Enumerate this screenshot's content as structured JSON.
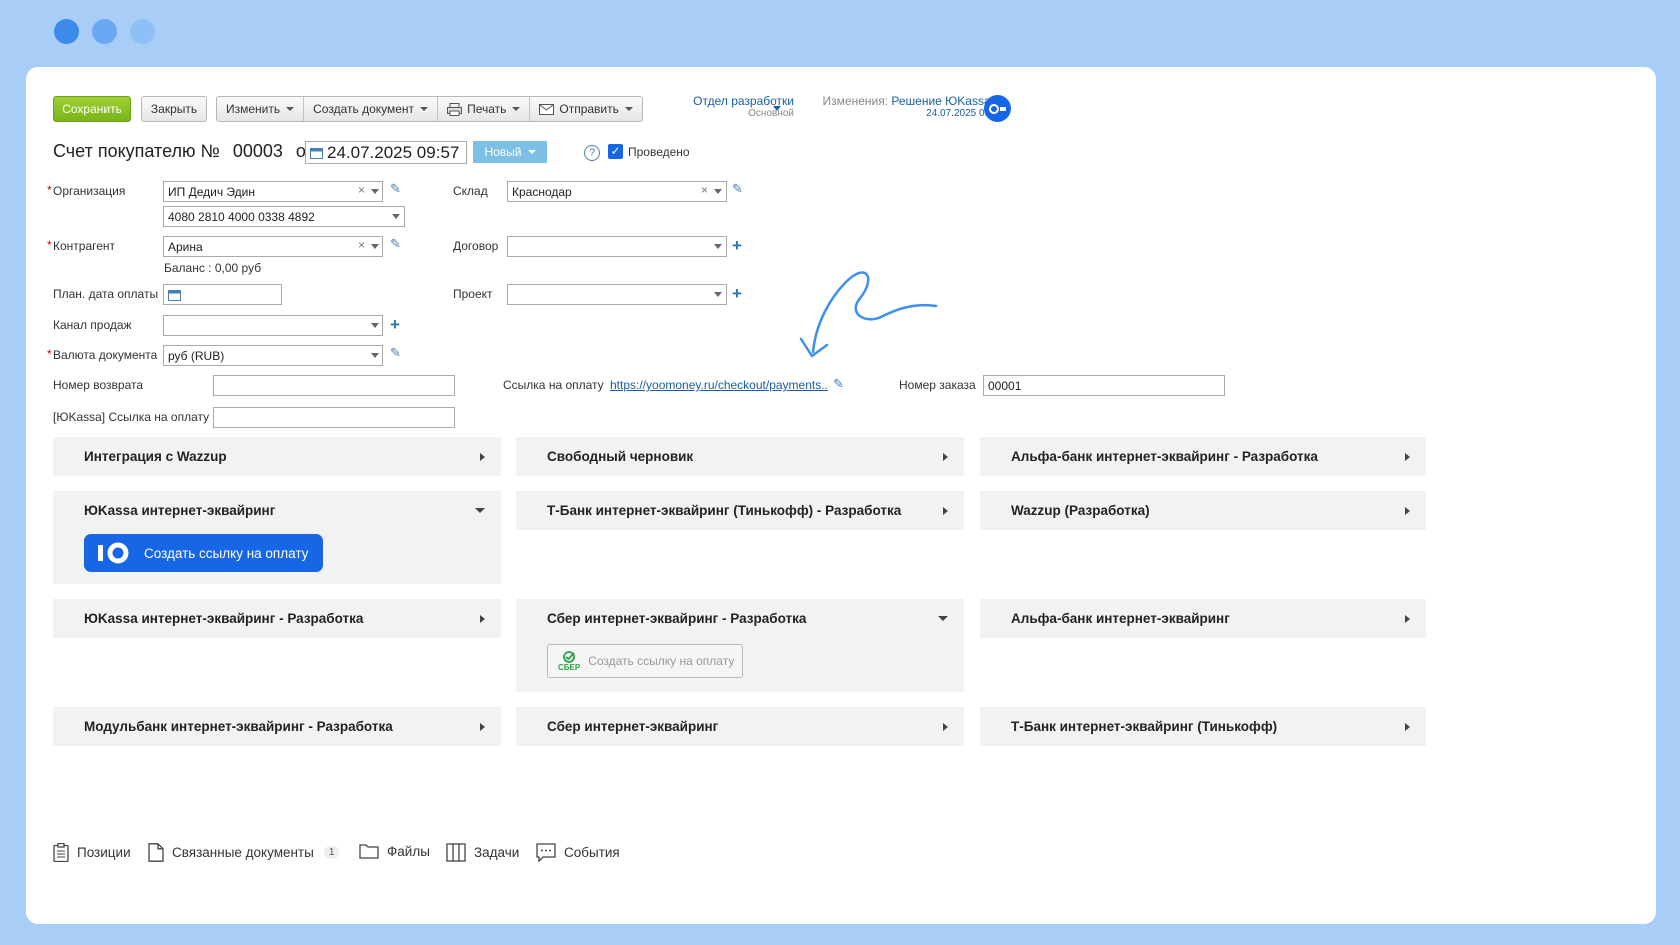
{
  "colors": {
    "frame": "#a8cdf6",
    "save": "#8cc229",
    "link": "#1a5fa3",
    "accent": "#1766e6"
  },
  "toolbar": {
    "save": "Сохранить",
    "close": "Закрыть",
    "edit": "Изменить",
    "create_doc": "Создать документ",
    "print": "Печать",
    "send": "Отправить"
  },
  "dept": {
    "name": "Отдел разработки",
    "sub": "Основной"
  },
  "changes": {
    "label": "Изменения:",
    "value": "Решение ЮKassa ...",
    "date": "24.07.2025 09:57"
  },
  "header": {
    "title": "Счет покупателю №",
    "number": "00003",
    "from": "от",
    "date": "24.07.2025 09:57",
    "status": "Новый",
    "posted": "Проведено",
    "help": "?"
  },
  "form": {
    "org_label": "Организация",
    "org_value": "ИП Дедич Эдин",
    "account_value": "4080 2810 4000 0338 4892",
    "warehouse_label": "Склад",
    "warehouse_value": "Краснодар",
    "contractor_label": "Контрагент",
    "contractor_value": "Арина",
    "balance": "Баланс : 0,00 руб",
    "contract_label": "Договор",
    "pay_date_label": "План. дата оплаты",
    "project_label": "Проект",
    "channel_label": "Канал продаж",
    "currency_label": "Валюта документа",
    "currency_value": "руб (RUB)",
    "return_label": "Номер возврата",
    "pay_link_label": "Ссылка на оплату",
    "pay_link_value": "https://yoomoney.ru/checkout/payments...",
    "order_label": "Номер заказа",
    "order_value": "00001",
    "yk_link_label": "[ЮKassa] Ссылка на оплату"
  },
  "panels": {
    "p1": "Интеграция с Wazzup",
    "p2": "Свободный черновик",
    "p3": "Альфа-банк интернет-эквайринг - Разработка",
    "p4": "ЮKassa интернет-эквайринг",
    "p5": "Т-Банк интернет-эквайринг (Тинькофф) - Разработка",
    "p6": "Wazzup (Разработка)",
    "p7": "ЮKassa интернет-эквайринг - Разработка",
    "p8": "Сбер интернет-эквайринг - Разработка",
    "p9": "Альфа-банк интернет-эквайринг",
    "p10": "Модульбанк интернет-эквайринг - Разработка",
    "p11": "Сбер интернет-эквайринг",
    "p12": "Т-Банк интернет-эквайринг (Тинькофф)",
    "yk_button": "Создать ссылку на оплату",
    "sber_button": "Создать ссылку на оплату",
    "sber_logo": "СБЕР"
  },
  "tabs": {
    "positions": "Позиции",
    "linked": "Связанные документы",
    "linked_count": "1",
    "files": "Файлы",
    "tasks": "Задачи",
    "events": "События"
  }
}
